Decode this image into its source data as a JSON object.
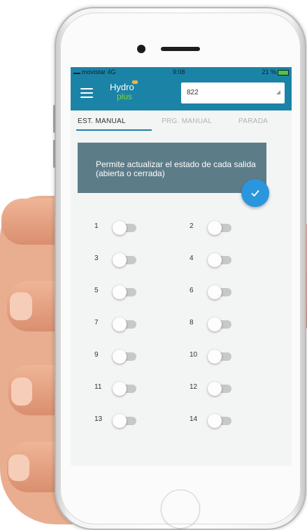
{
  "status_bar": {
    "carrier": "movistar 4G",
    "time": "9:08",
    "battery": "21 %"
  },
  "app": {
    "logo_text": "Hydro",
    "logo_sub": "plus",
    "device_value": "822"
  },
  "tabs": [
    {
      "label": "EST. MANUAL",
      "active": true
    },
    {
      "label": "PRG. MANUAL",
      "active": false
    },
    {
      "label": "PARADA",
      "active": false
    }
  ],
  "info": {
    "text": "Permite actualizar el estado de cada salida (abierta o cerrada)"
  },
  "outputs": [
    {
      "label": "1",
      "on": false
    },
    {
      "label": "2",
      "on": false
    },
    {
      "label": "3",
      "on": false
    },
    {
      "label": "4",
      "on": false
    },
    {
      "label": "5",
      "on": false
    },
    {
      "label": "6",
      "on": false
    },
    {
      "label": "7",
      "on": false
    },
    {
      "label": "8",
      "on": false
    },
    {
      "label": "9",
      "on": false
    },
    {
      "label": "10",
      "on": false
    },
    {
      "label": "11",
      "on": false
    },
    {
      "label": "12",
      "on": false
    },
    {
      "label": "13",
      "on": false
    },
    {
      "label": "14",
      "on": false
    }
  ],
  "colors": {
    "primary": "#1b83a6",
    "card": "#5c7c88",
    "fab": "#2b95dd",
    "brand_green": "#7dd33a"
  },
  "icons": {
    "menu": "menu-icon",
    "confirm": "check-icon",
    "dropdown": "chevron-down-icon"
  }
}
